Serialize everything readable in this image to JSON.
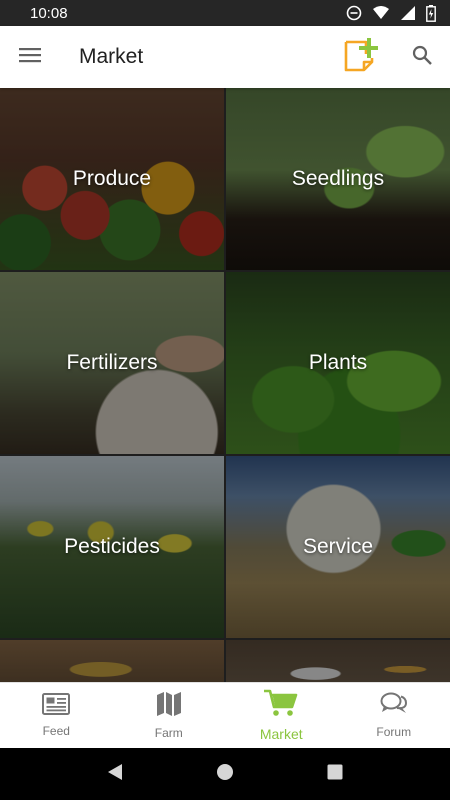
{
  "status_bar": {
    "time": "10:08"
  },
  "app_bar": {
    "title": "Market"
  },
  "categories": [
    {
      "label": "Produce"
    },
    {
      "label": "Seedlings"
    },
    {
      "label": "Fertilizers"
    },
    {
      "label": "Plants"
    },
    {
      "label": "Pesticides"
    },
    {
      "label": "Service"
    }
  ],
  "bottom_nav": {
    "items": [
      {
        "label": "Feed",
        "icon": "newspaper-icon"
      },
      {
        "label": "Farm",
        "icon": "map-icon"
      },
      {
        "label": "Market",
        "icon": "cart-icon"
      },
      {
        "label": "Forum",
        "icon": "chat-bubbles-icon"
      }
    ],
    "active": "Market"
  },
  "colors": {
    "accent": "#8bc53f",
    "add_icon_orange": "#f5a623",
    "inactive": "#757575"
  }
}
